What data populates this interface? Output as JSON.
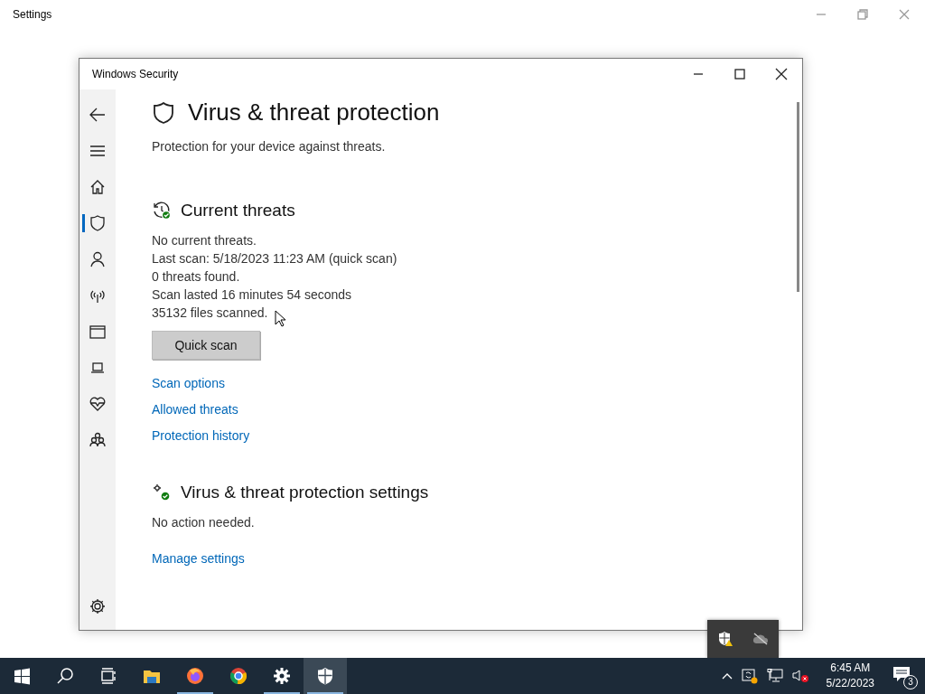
{
  "background_window": {
    "title": "Settings"
  },
  "window": {
    "title": "Windows Security"
  },
  "sidebar": {
    "items": [
      {
        "kind": "back",
        "selected": false
      },
      {
        "kind": "menu",
        "selected": false
      },
      {
        "kind": "home",
        "selected": false
      },
      {
        "kind": "shield",
        "selected": true
      },
      {
        "kind": "account",
        "selected": false
      },
      {
        "kind": "network",
        "selected": false
      },
      {
        "kind": "app",
        "selected": false
      },
      {
        "kind": "device",
        "selected": false
      },
      {
        "kind": "health",
        "selected": false
      },
      {
        "kind": "family",
        "selected": false
      }
    ],
    "footer": {
      "kind": "settings",
      "selected": false
    }
  },
  "page": {
    "title": "Virus & threat protection",
    "subtitle": "Protection for your device against threats."
  },
  "sections": [
    {
      "kind": "threats",
      "title": "Current threats",
      "lines": [
        "No current threats.",
        "Last scan: 5/18/2023 11:23 AM (quick scan)",
        "0 threats found.",
        "Scan lasted 16 minutes 54 seconds",
        "35132 files scanned."
      ],
      "button": "Quick scan",
      "links": [
        "Scan options",
        "Allowed threats",
        "Protection history"
      ]
    },
    {
      "kind": "settings",
      "title": "Virus & threat protection settings",
      "lines": [
        "No action needed."
      ],
      "links": [
        "Manage settings"
      ]
    }
  ],
  "tray_popup": {
    "items": [
      {
        "kind": "security-warning"
      },
      {
        "kind": "cloud-off"
      }
    ]
  },
  "taskbar": {
    "apps": [
      {
        "kind": "start",
        "running": false,
        "active": false
      },
      {
        "kind": "search",
        "running": false,
        "active": false
      },
      {
        "kind": "taskview",
        "running": false,
        "active": false
      },
      {
        "kind": "explorer",
        "running": false,
        "active": false
      },
      {
        "kind": "firefox",
        "running": true,
        "active": false
      },
      {
        "kind": "chrome",
        "running": false,
        "active": false
      },
      {
        "kind": "settings",
        "running": true,
        "active": false
      },
      {
        "kind": "security",
        "running": true,
        "active": true
      }
    ],
    "time": "6:45 AM",
    "date": "5/22/2023",
    "notifications": "3"
  }
}
